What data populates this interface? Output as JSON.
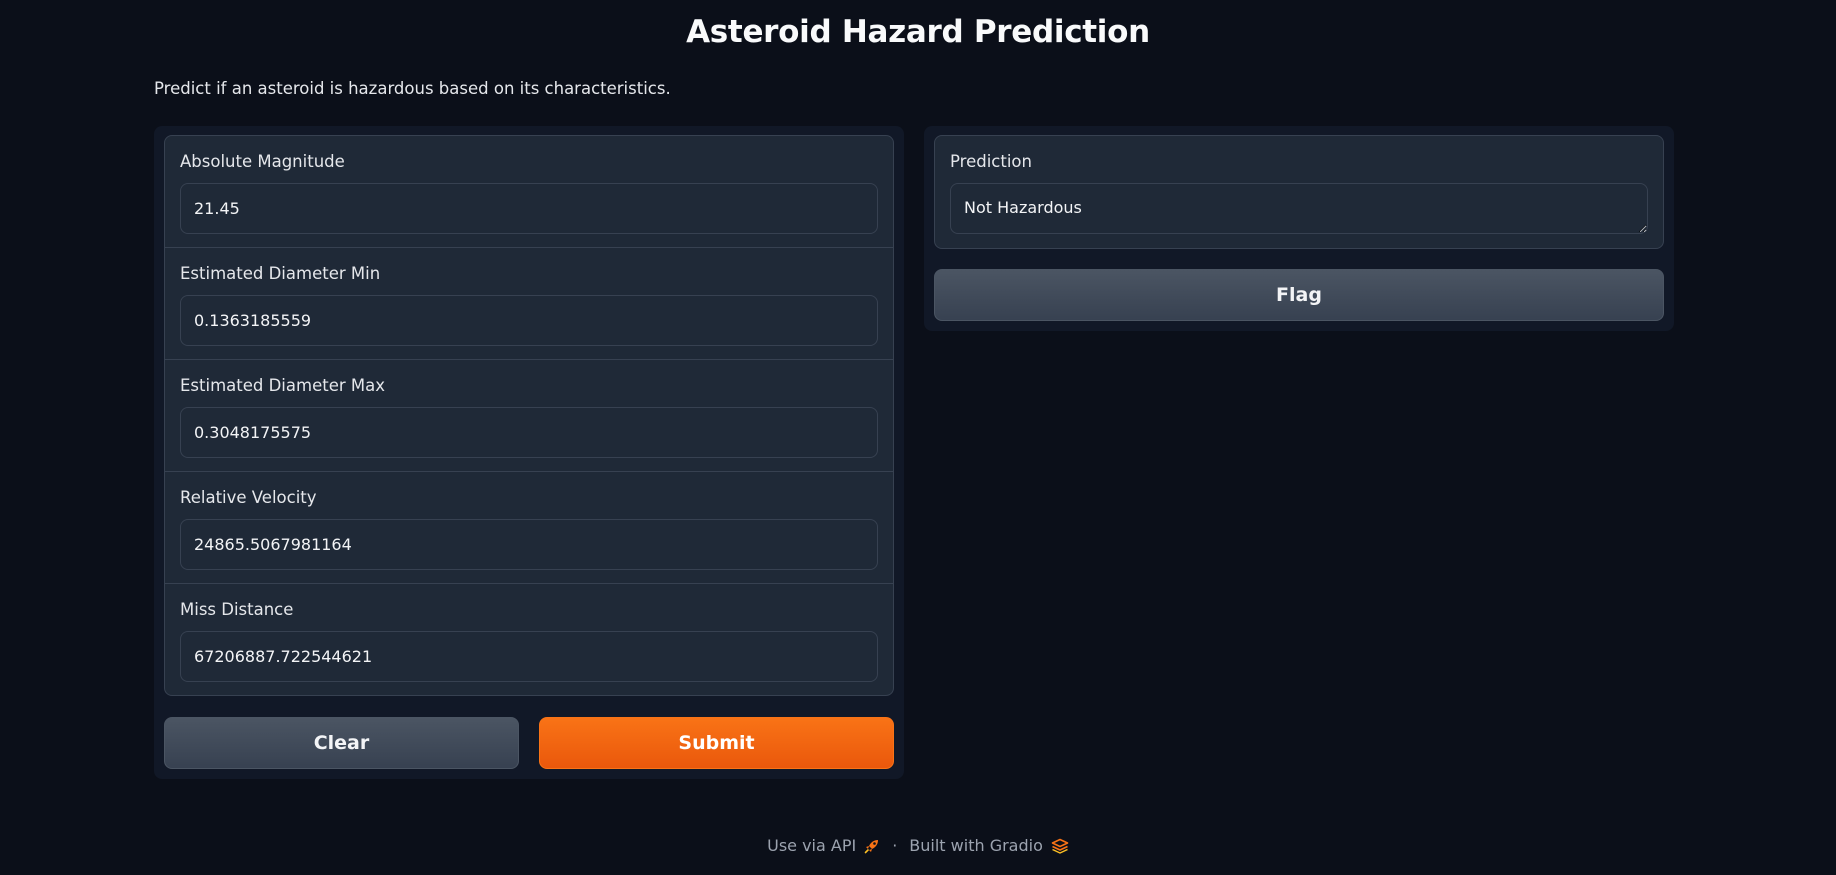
{
  "page": {
    "title": "Asteroid Hazard Prediction",
    "description": "Predict if an asteroid is hazardous based on its characteristics."
  },
  "inputs": [
    {
      "label": "Absolute Magnitude",
      "value": "21.45"
    },
    {
      "label": "Estimated Diameter Min",
      "value": "0.1363185559"
    },
    {
      "label": "Estimated Diameter Max",
      "value": "0.3048175575"
    },
    {
      "label": "Relative Velocity",
      "value": "24865.5067981164"
    },
    {
      "label": "Miss Distance",
      "value": "67206887.722544621"
    }
  ],
  "buttons": {
    "clear": "Clear",
    "submit": "Submit",
    "flag": "Flag"
  },
  "output": {
    "label": "Prediction",
    "value": "Not Hazardous"
  },
  "footer": {
    "api_link": "Use via API",
    "api_icon": "rocket-icon",
    "separator": "·",
    "built_with": "Built with Gradio",
    "gradio_icon": "gradio-logo-icon"
  },
  "colors": {
    "background": "#0b0f19",
    "panel": "#111827",
    "block": "#1f2937",
    "border": "#374151",
    "primary": "#f97316",
    "secondary": "#4b5563"
  }
}
